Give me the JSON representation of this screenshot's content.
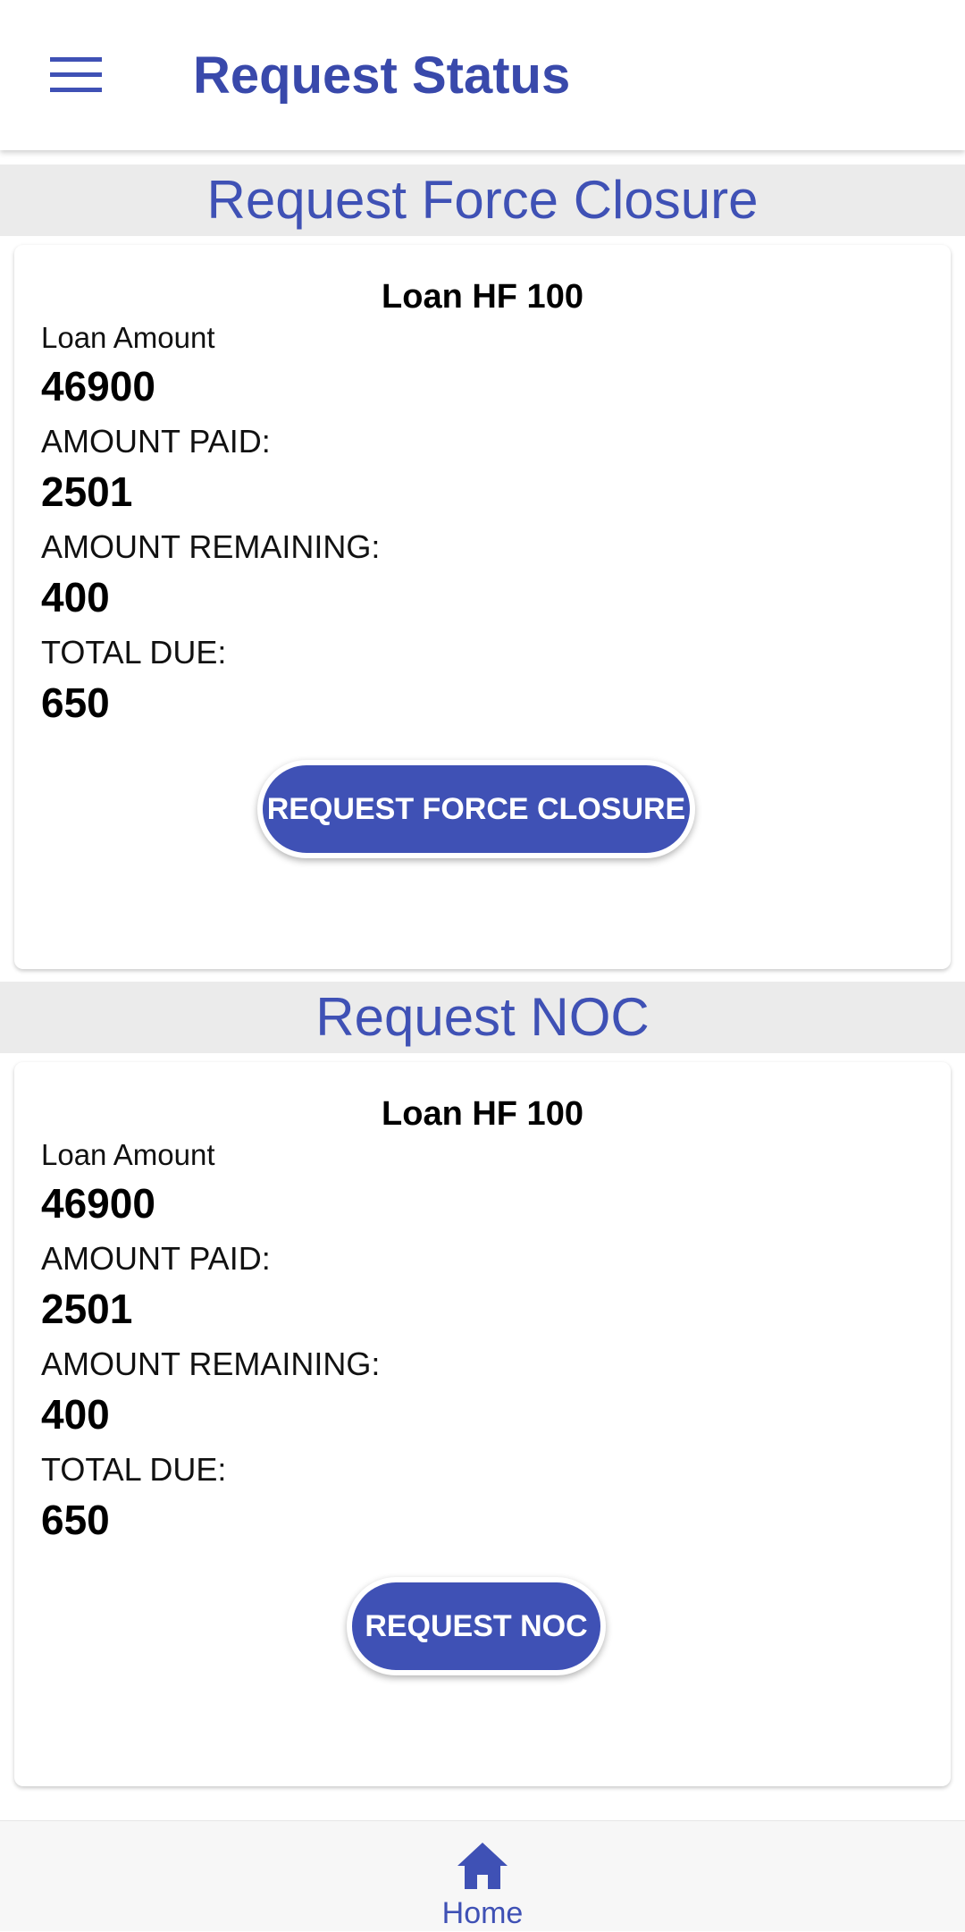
{
  "app_bar": {
    "title": "Request Status",
    "menu_icon": "hamburger-menu-icon"
  },
  "sections": [
    {
      "header": "Request Force Closure",
      "card": {
        "loan_title": "Loan HF 100",
        "loan_amount_label": "Loan Amount",
        "loan_amount": "46900",
        "amount_paid_label": "AMOUNT PAID:",
        "amount_paid": "2501",
        "amount_remaining_label": "AMOUNT REMAINING:",
        "amount_remaining": "400",
        "total_due_label": "TOTAL DUE:",
        "total_due": "650",
        "button_label": "REQUEST FORCE CLOSURE"
      }
    },
    {
      "header": "Request NOC",
      "card": {
        "loan_title": "Loan HF 100",
        "loan_amount_label": "Loan Amount",
        "loan_amount": "46900",
        "amount_paid_label": "AMOUNT PAID:",
        "amount_paid": "2501",
        "amount_remaining_label": "AMOUNT REMAINING:",
        "amount_remaining": "400",
        "total_due_label": "TOTAL DUE:",
        "total_due": "650",
        "button_label": "REQUEST NOC"
      }
    }
  ],
  "bottom_nav": {
    "items": [
      {
        "label": "Home",
        "icon": "home-icon",
        "active": true
      }
    ]
  },
  "colors": {
    "primary": "#3f51b5",
    "title": "#3949ab",
    "section_header_bg": "#ebebeb",
    "bottom_nav_bg": "#f7f7f7"
  }
}
